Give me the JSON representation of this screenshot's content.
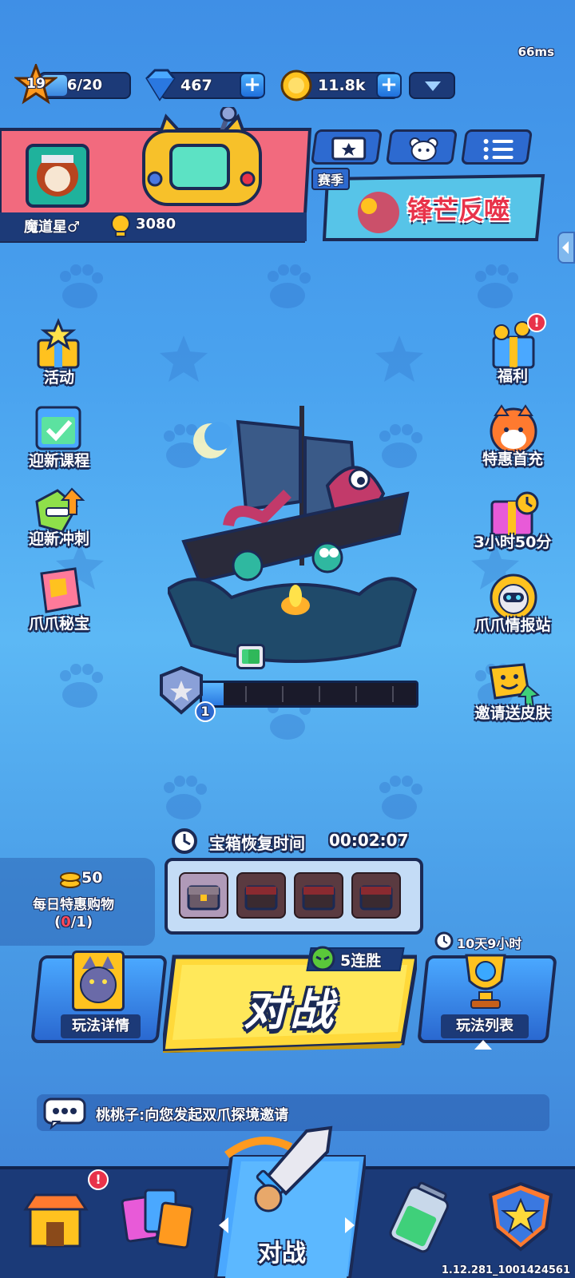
{
  "status": {
    "ping": "66ms"
  },
  "player": {
    "level": "19",
    "xp": "6/20",
    "xp_fraction": 0.3,
    "name": "魔道星♂",
    "trophies": "3080"
  },
  "currency": {
    "gems": "467",
    "coins": "11.8k"
  },
  "season": {
    "tag": "赛季",
    "title": "锋芒反噬"
  },
  "left_menu": [
    {
      "label": "活动",
      "icon": "gift-box-star-icon"
    },
    {
      "label": "迎新课程",
      "icon": "calendar-check-icon"
    },
    {
      "label": "迎新冲刺",
      "icon": "grin-arrow-up-icon"
    },
    {
      "label": "爪爪秘宝",
      "icon": "treasure-shirt-icon"
    }
  ],
  "right_menu": [
    {
      "label": "福利",
      "icon": "gift-coins-icon"
    },
    {
      "label": "特惠首充",
      "icon": "fox-avatar-icon"
    },
    {
      "label": "3小时50分",
      "icon": "pink-gift-clock-icon"
    },
    {
      "label": "爪爪情报站",
      "icon": "intel-robot-icon"
    },
    {
      "label": "邀请送皮肤",
      "icon": "smiley-arrow-icon"
    }
  ],
  "rank": {
    "badge_number": "1",
    "progress_fraction": 0.1
  },
  "chest_timer": {
    "label": "宝箱恢复时间",
    "time": "00:02:07"
  },
  "daily_deal": {
    "coins": "50",
    "label": "每日特惠购物",
    "count_current": "0",
    "count_total": "/1)",
    "count_open": "("
  },
  "battle": {
    "streak": "5连胜",
    "button_label": "对战",
    "mode_details": "玩法详情",
    "mode_list": "玩法列表",
    "mode_list_timer": "10天9小时"
  },
  "chat": {
    "message": "桃桃子:向您发起双爪探境邀请"
  },
  "bottom_nav": [
    {
      "label": "",
      "icon": "shop-icon"
    },
    {
      "label": "",
      "icon": "cards-icon"
    },
    {
      "label": "对战",
      "icon": "sword-icon"
    },
    {
      "label": "",
      "icon": "battery-icon"
    },
    {
      "label": "",
      "icon": "star-shield-icon"
    }
  ],
  "version": "1.12.281_1001424561",
  "colors": {
    "accent_yellow": "#ffd93a",
    "alert_red": "#e8334a",
    "panel_dark": "#1c3a78"
  }
}
